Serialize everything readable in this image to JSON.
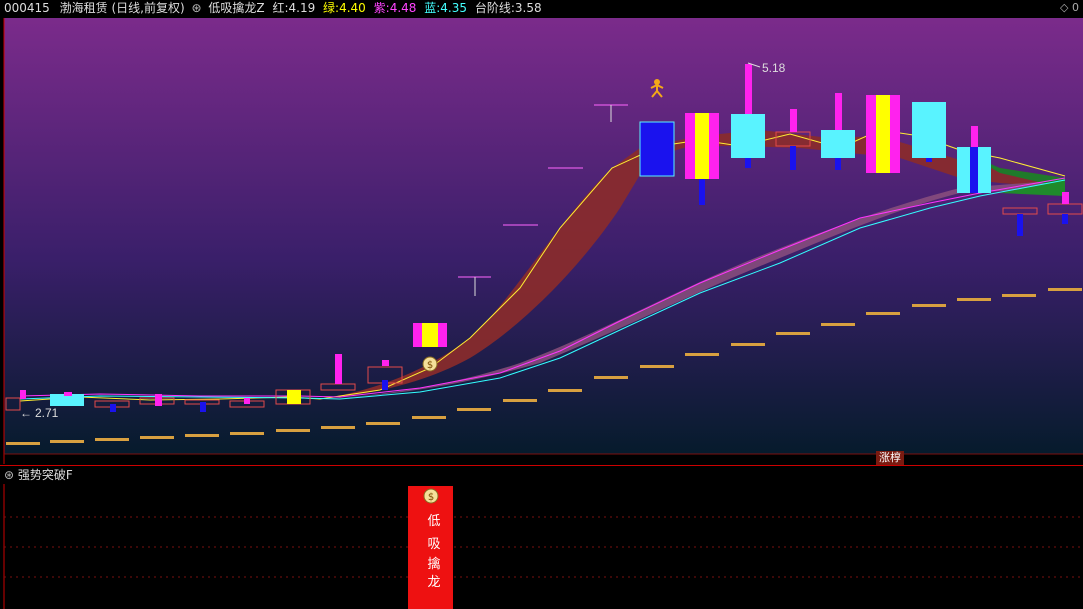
{
  "header": {
    "code": "000415",
    "name": "渤海租赁",
    "period": "(日线,前复权)",
    "indicator": "低吸擒龙Z",
    "items": [
      {
        "label": "红: ",
        "value": "4.19",
        "color": "#ff3333"
      },
      {
        "label": "绿: ",
        "value": "4.40",
        "color": "#ffff00"
      },
      {
        "label": "紫: ",
        "value": "4.48",
        "color": "#ff00ff"
      },
      {
        "label": "蓝: ",
        "value": "4.35",
        "color": "#00ffff"
      },
      {
        "label": "台阶线: ",
        "value": "3.58",
        "color": "#dddddd"
      }
    ]
  },
  "main_chart": {
    "price_max_label": "5.18",
    "price_min_label": "2.71",
    "tag": "涨椁"
  },
  "sub_panel": {
    "title": "强势突破F",
    "bar_label": [
      "低",
      "吸",
      "擒",
      "龙"
    ]
  },
  "colors": {
    "background_top": "#7a2a88",
    "background_bottom": "#061b2c",
    "signal_bar": "#ee1111",
    "label_text": "#ffffff"
  }
}
